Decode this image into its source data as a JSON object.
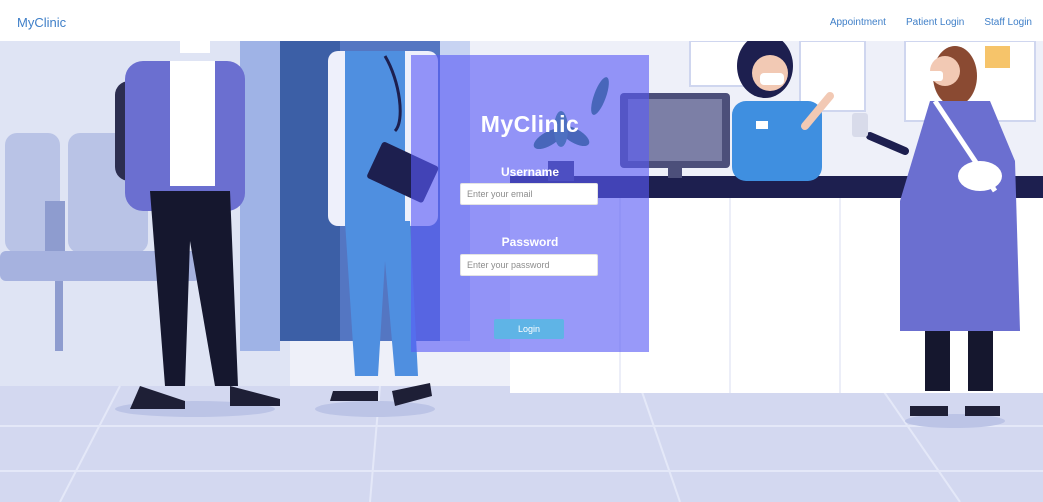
{
  "navbar": {
    "brand": "MyClinic",
    "links": [
      {
        "label": "Appointment"
      },
      {
        "label": "Patient Login"
      },
      {
        "label": "Staff Login"
      }
    ]
  },
  "login": {
    "title": "MyClinic",
    "username_label": "Username",
    "username_placeholder": "Enter your email",
    "username_value": "",
    "password_label": "Password",
    "password_placeholder": "Enter your password",
    "password_value": "",
    "submit_label": "Login"
  },
  "colors": {
    "brand_link": "#3f7fc8",
    "panel_overlay": "#585af5",
    "button": "#5fb4e6"
  },
  "icons": {
    "hero": "clinic-reception-illustration"
  }
}
